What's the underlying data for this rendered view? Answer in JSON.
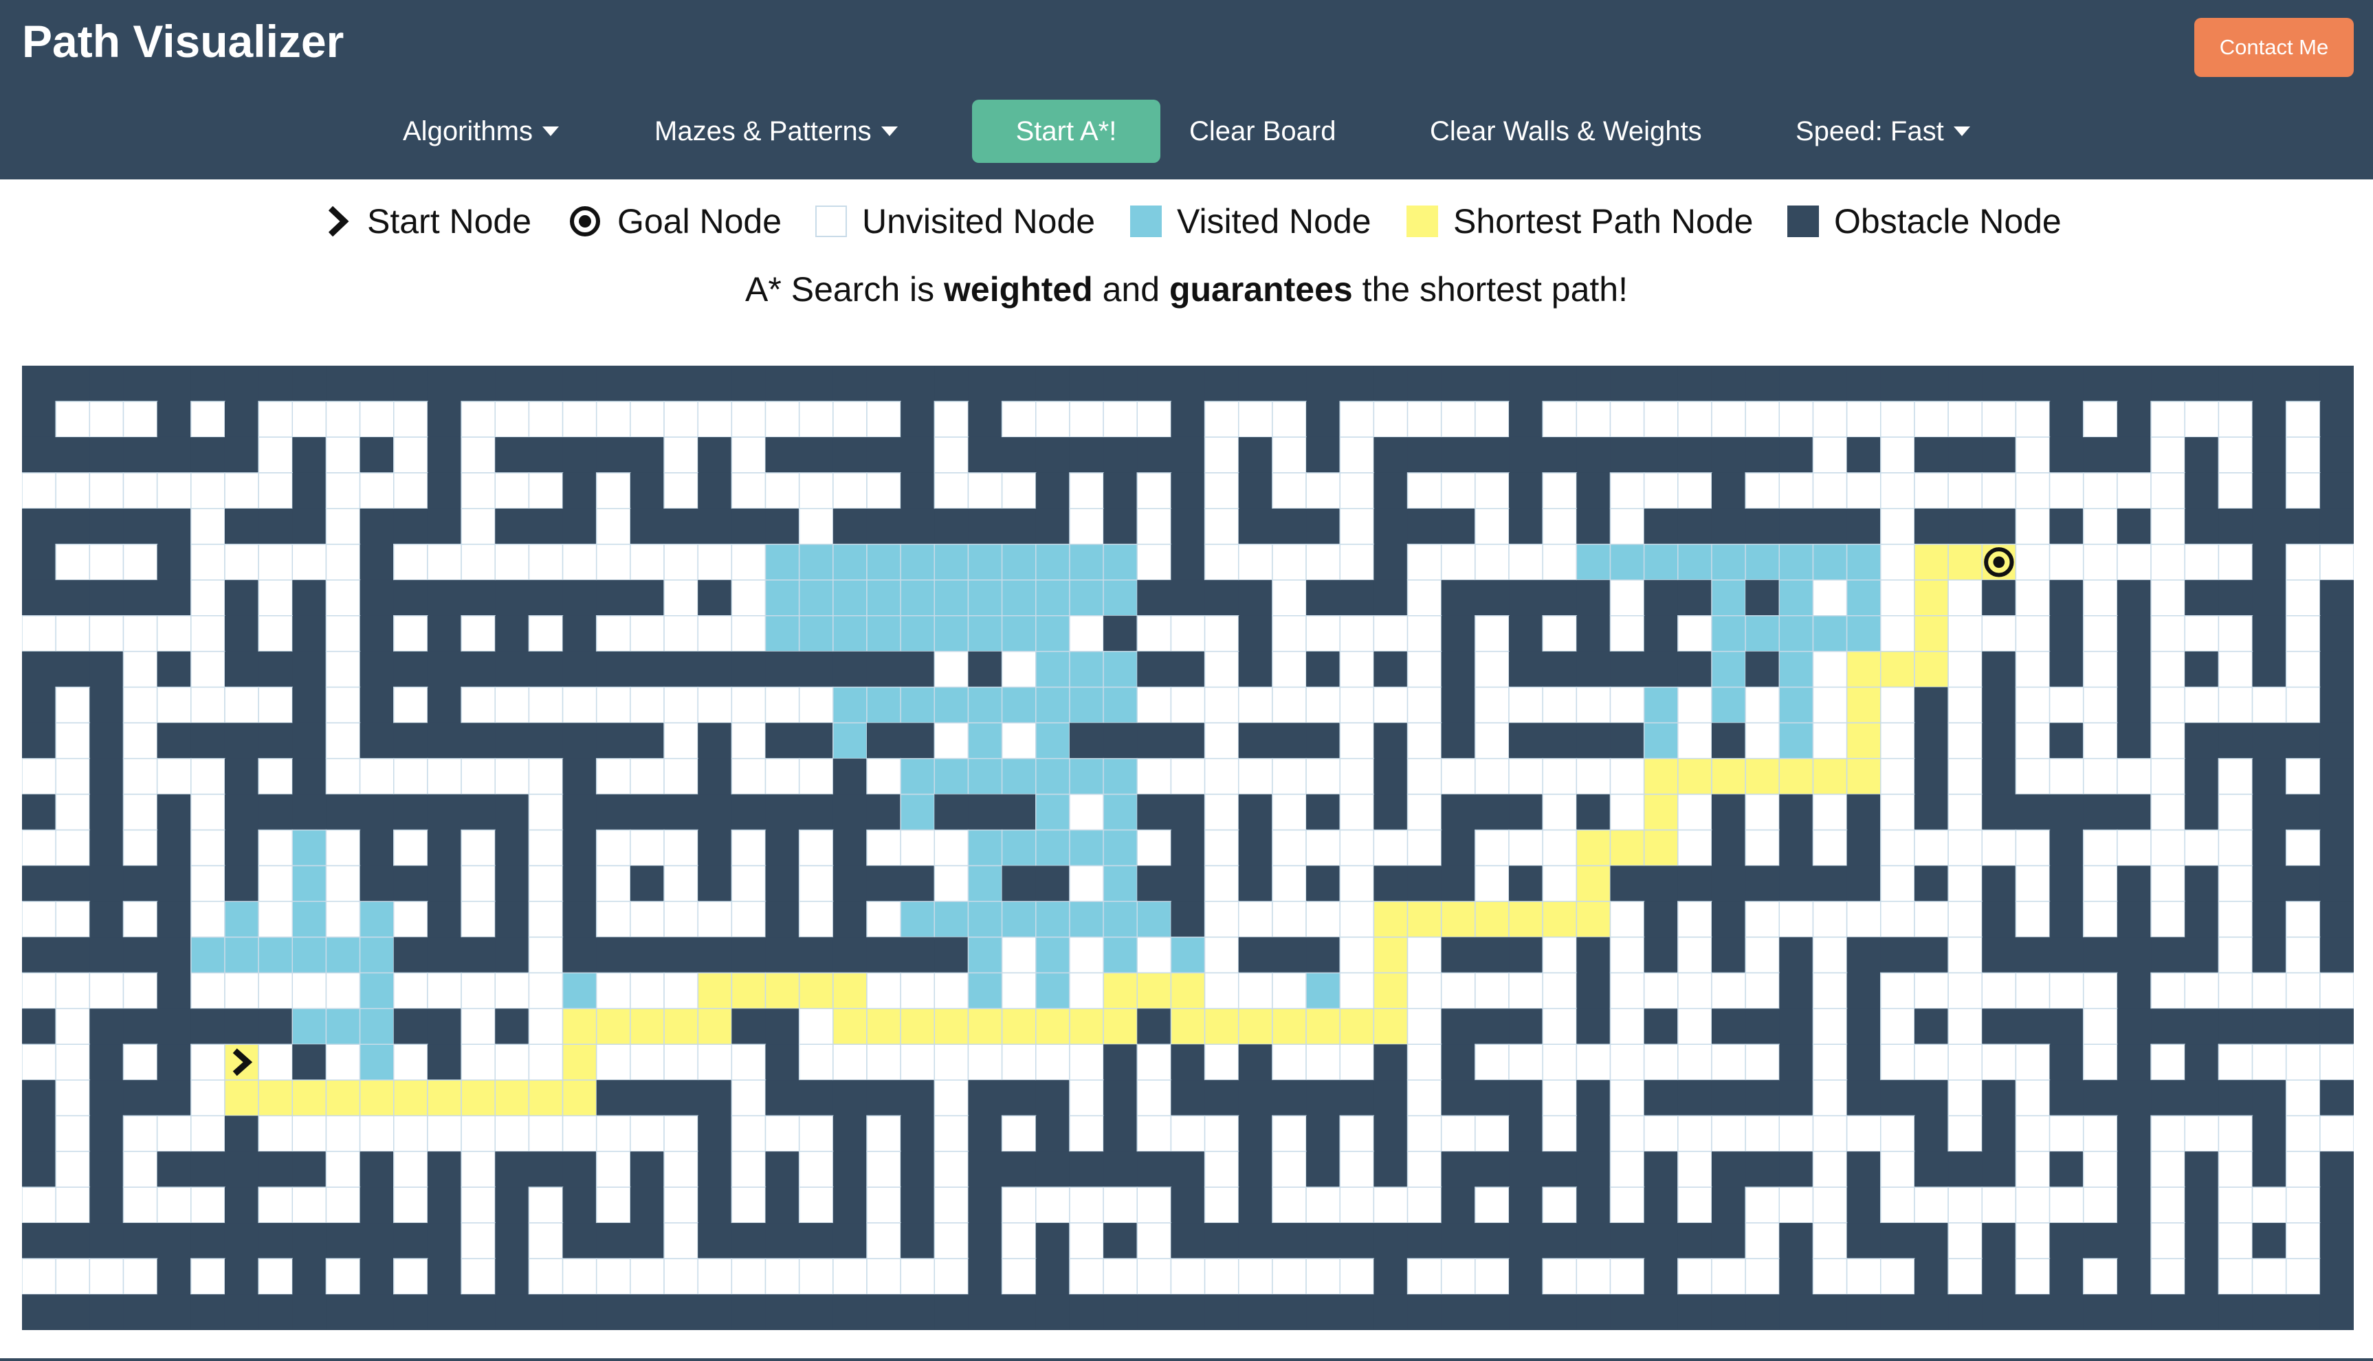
{
  "app": {
    "title": "Path Visualizer",
    "contact_label": "Contact Me"
  },
  "menu": {
    "algorithms": "Algorithms",
    "mazes": "Mazes & Patterns",
    "start": "Start A*!",
    "clear_board": "Clear Board",
    "clear_walls": "Clear Walls & Weights",
    "speed": "Speed: Fast"
  },
  "legend": {
    "start": "Start Node",
    "goal": "Goal Node",
    "unvisited": "Unvisited Node",
    "visited": "Visited Node",
    "shortest": "Shortest Path Node",
    "obstacle": "Obstacle Node"
  },
  "description": {
    "prefix": "A* Search is ",
    "strong1": "weighted",
    "middle": " and ",
    "strong2": "guarantees",
    "suffix": " the shortest path!"
  },
  "colors": {
    "navbar": "#34495e",
    "contact": "#ef8354",
    "start_button": "#5cba9a",
    "wall": "#34495e",
    "visited": "#7fcce0",
    "shortest_path": "#fdf77c",
    "unvisited_border": "#c8dbe8"
  },
  "icons": {
    "start": "chevron-right-icon",
    "goal": "target-icon"
  }
}
